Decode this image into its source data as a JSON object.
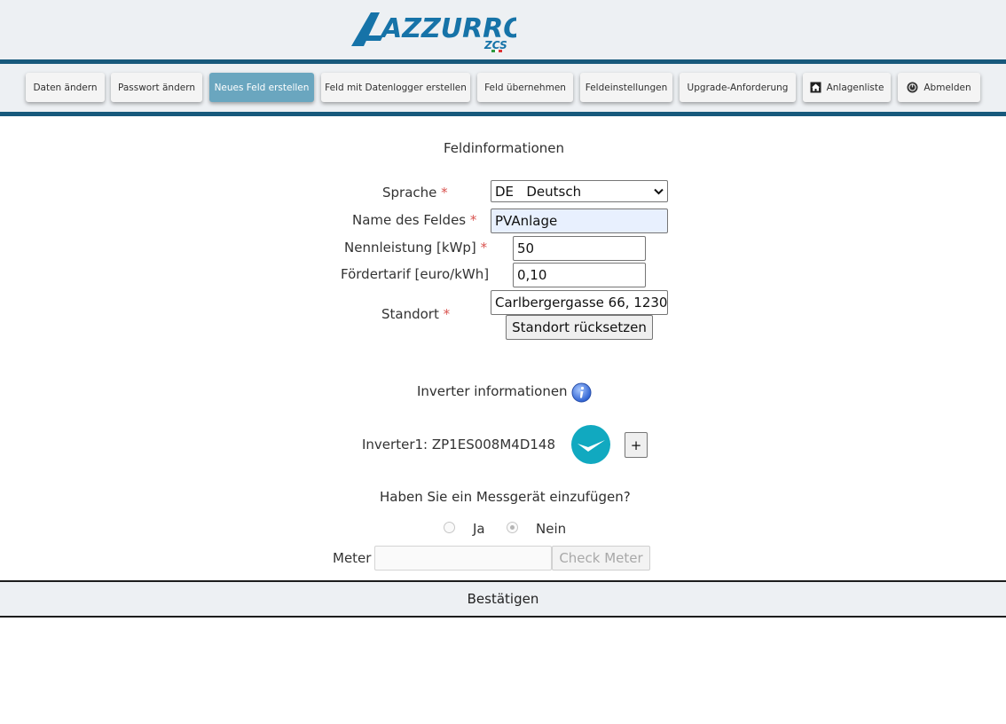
{
  "brand": {
    "logo_text": "AZZURRO",
    "logo_sub": "ZCS"
  },
  "nav": {
    "items": [
      {
        "label": "Daten ändern"
      },
      {
        "label": "Passwort ändern"
      },
      {
        "label": "Neues Feld erstellen",
        "active": true
      },
      {
        "label": "Feld mit Datenlogger erstellen"
      },
      {
        "label": "Feld übernehmen"
      },
      {
        "label": "Feldeinstellungen"
      },
      {
        "label": "Upgrade-Anforderung"
      },
      {
        "label": "Anlagenliste",
        "icon": "home-icon"
      },
      {
        "label": "Abmelden",
        "icon": "power-icon"
      }
    ]
  },
  "form": {
    "title": "Feldinformationen",
    "language": {
      "label": "Sprache",
      "required_mark": "*",
      "value_code": "DE",
      "value_name": "Deutsch"
    },
    "field_name": {
      "label": "Name des Feldes",
      "required_mark": "*",
      "value": "PVAnlage"
    },
    "nominal_power": {
      "label": "Nennleistung [kWp]",
      "required_mark": "*",
      "value": "50"
    },
    "tariff": {
      "label": "Fördertarif [euro/kWh]",
      "value": "0,10"
    },
    "location": {
      "label": "Standort",
      "required_mark": "*",
      "value": "Carlbergergasse 66, 1230",
      "reset_label": "Standort rücksetzen"
    }
  },
  "inverter": {
    "title": "Inverter informationen",
    "items": [
      {
        "label": "Inverter1: ZP1ES008M4D148"
      }
    ],
    "add_label": "+"
  },
  "meter": {
    "question": "Haben Sie ein Messgerät einzufügen?",
    "yes_label": "Ja",
    "no_label": "Nein",
    "selected": "Nein",
    "field_label": "Meter",
    "value": "",
    "check_label": "Check Meter"
  },
  "confirm_label": "Bestätigen",
  "colors": {
    "brand": "#1673a8",
    "accent": "#17597c",
    "active_tab": "#6aa6bf",
    "check_circle": "#11a9c0",
    "required": "#d9534f"
  }
}
